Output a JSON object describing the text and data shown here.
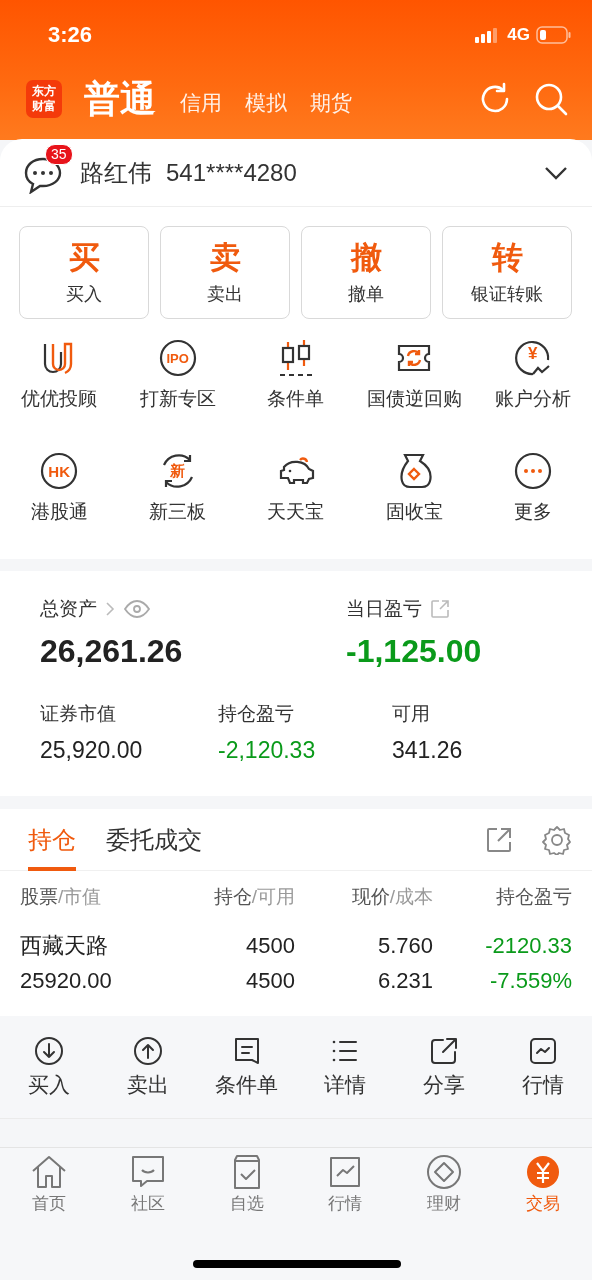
{
  "status_bar": {
    "time": "3:26",
    "network": "4G"
  },
  "header": {
    "logo": "东方财富",
    "tabs": [
      {
        "label": "普通",
        "selected": true
      },
      {
        "label": "信用",
        "selected": false
      },
      {
        "label": "模拟",
        "selected": false
      },
      {
        "label": "期货",
        "selected": false
      }
    ]
  },
  "account": {
    "badge": "35",
    "name": "路红伟",
    "number": "541****4280"
  },
  "trade_buttons": [
    {
      "glyph": "买",
      "label": "买入"
    },
    {
      "glyph": "卖",
      "label": "卖出"
    },
    {
      "glyph": "撤",
      "label": "撤单"
    },
    {
      "glyph": "转",
      "label": "银证转账"
    }
  ],
  "services": [
    {
      "kind": "advisor",
      "label": "优优投顾"
    },
    {
      "kind": "ipo",
      "icon_text": "IPO",
      "label": "打新专区"
    },
    {
      "kind": "candles",
      "label": "条件单"
    },
    {
      "kind": "repo",
      "label": "国债逆回购"
    },
    {
      "kind": "analysis",
      "icon_text": "¥",
      "label": "账户分析"
    },
    {
      "kind": "hk",
      "icon_text": "HK",
      "label": "港股通"
    },
    {
      "kind": "neeq",
      "icon_text": "新",
      "label": "新三板"
    },
    {
      "kind": "piggy",
      "label": "天天宝"
    },
    {
      "kind": "bag",
      "label": "固收宝"
    },
    {
      "kind": "more",
      "label": "更多"
    }
  ],
  "assets": {
    "total_label": "总资产",
    "total": "26,261.26",
    "daily": {
      "label": "当日盈亏",
      "value": "-1,125.00",
      "color": "#0a9a1a"
    },
    "metrics": [
      {
        "label": "证券市值",
        "value": "25,920.00",
        "color": "#222222"
      },
      {
        "label": "持仓盈亏",
        "value": "-2,120.33",
        "color": "#0a9a1a"
      },
      {
        "label": "可用",
        "value": "341.26",
        "color": "#222222"
      }
    ]
  },
  "positions": {
    "tabs": [
      {
        "label": "持仓",
        "selected": true
      },
      {
        "label": "委托成交",
        "selected": false
      }
    ],
    "columns": [
      {
        "main": "股票",
        "sub": "/市值"
      },
      {
        "main": "持仓",
        "sub": "/可用"
      },
      {
        "main": "现价",
        "sub": "/成本"
      },
      {
        "main": "持仓盈亏"
      }
    ],
    "rows": [
      {
        "name": "西藏天路",
        "market_value": "25920.00",
        "quantity": "4500",
        "available": "4500",
        "price": "5.760",
        "cost": "6.231",
        "pnl": "-2120.33",
        "pnl_pct": "-7.559%",
        "color": "#0a9a1a"
      }
    ]
  },
  "actions": [
    {
      "kind": "buy",
      "label": "买入"
    },
    {
      "kind": "sell",
      "label": "卖出"
    },
    {
      "kind": "condition",
      "label": "条件单"
    },
    {
      "kind": "details",
      "label": "详情"
    },
    {
      "kind": "share",
      "label": "分享"
    },
    {
      "kind": "quote",
      "label": "行情"
    }
  ],
  "nav": [
    {
      "kind": "home",
      "label": "首页",
      "selected": false
    },
    {
      "kind": "community",
      "label": "社区",
      "selected": false
    },
    {
      "kind": "watchlist",
      "label": "自选",
      "selected": false
    },
    {
      "kind": "market",
      "label": "行情",
      "selected": false
    },
    {
      "kind": "wealth",
      "label": "理财",
      "selected": false
    },
    {
      "kind": "trade",
      "label": "交易",
      "selected": true
    }
  ]
}
